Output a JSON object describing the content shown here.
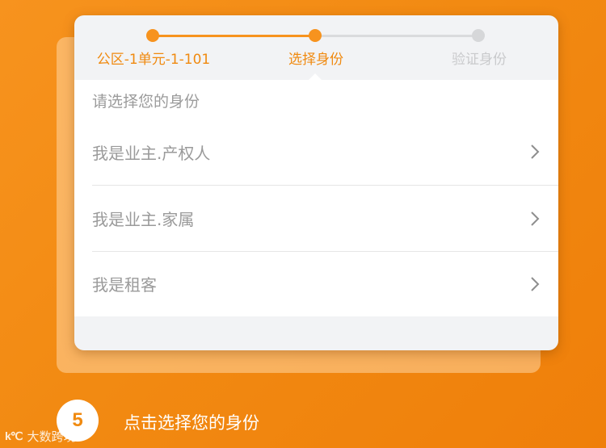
{
  "stepper": {
    "steps": [
      {
        "label": "公区-1单元-1-101",
        "state": "done"
      },
      {
        "label": "选择身份",
        "state": "current"
      },
      {
        "label": "验证身份",
        "state": "pending"
      }
    ]
  },
  "panel": {
    "prompt": "请选择您的身份",
    "options": [
      {
        "label": "我是业主.产权人",
        "icon": "chevron-right-icon"
      },
      {
        "label": "我是业主.家属",
        "icon": "chevron-right-icon"
      },
      {
        "label": "我是租客",
        "icon": "chevron-right-icon"
      }
    ]
  },
  "instruction": {
    "step_number": "5",
    "text": "点击选择您的身份"
  },
  "watermark": {
    "logo": "k℃",
    "text": "大数跨境"
  },
  "colors": {
    "accent": "#f7931e",
    "background": "#f28a12",
    "inactive": "#d6d7d9"
  }
}
